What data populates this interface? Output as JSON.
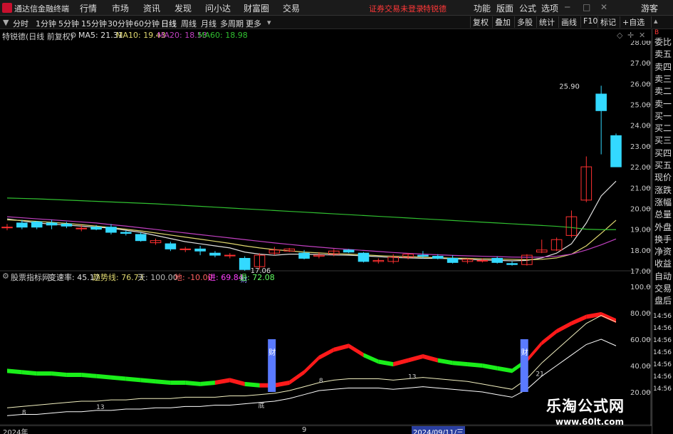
{
  "app": {
    "title": "通达信金融终端",
    "login_warning": "证券交易未登录",
    "user": "特锐德",
    "guest": "游客"
  },
  "menu": [
    "行情",
    "市场",
    "资讯",
    "发现",
    "问小达",
    "财富圈",
    "交易"
  ],
  "right_menu": [
    "功能",
    "版面",
    "公式",
    "选项"
  ],
  "periods": [
    "分时",
    "1分钟",
    "5分钟",
    "15分钟",
    "30分钟",
    "60分钟",
    "日线",
    "周线",
    "月线",
    "多周期",
    "更多"
  ],
  "active_period": "日线",
  "toolbar_right": [
    "复权",
    "叠加",
    "多股",
    "统计",
    "画线",
    "F10",
    "标记",
    "+自选"
  ],
  "main_info": {
    "name": "特锐德(日线 前复权)",
    "ma5": "MA5: 21.31",
    "ma10": "MA10: 19.43",
    "ma20": "MA20: 18.53",
    "ma60": "MA60: 18.98"
  },
  "price_axis": [
    "28.00",
    "27.00",
    "26.00",
    "25.00",
    "24.00",
    "23.00",
    "22.00",
    "21.00",
    "20.00",
    "19.00",
    "18.00",
    "17.00"
  ],
  "annotations": {
    "high": "25.90",
    "low": "17.06",
    "cai": "财",
    "di": "底"
  },
  "sub_info": {
    "name": "股票指标网",
    "rate_label": "变速率: 45.17",
    "trend": "趋势线: 76.73",
    "tian": "天: 100.00",
    "di": "地: -10.00",
    "jin": "进: 69.84",
    "tui": "退: 72.08"
  },
  "sub_axis": [
    "100.0",
    "80.00",
    "60.00",
    "40.00",
    "20.00"
  ],
  "sub_numbers": {
    "n8": "8",
    "n13": "13",
    "n13b": "13",
    "n8b": "8",
    "n21": "21"
  },
  "right_panel": [
    "委比",
    "卖五",
    "卖四",
    "卖三",
    "卖二",
    "卖一",
    "买一",
    "买二",
    "买三",
    "买四",
    "买五",
    "现价",
    "涨跌",
    "涨幅",
    "总量",
    "外盘",
    "换手",
    "净资",
    "收益",
    "自动",
    "交易",
    "盘后"
  ],
  "right_times": [
    "14:56",
    "14:56",
    "14:56",
    "14:56",
    "14:56",
    "14:56",
    "14:56"
  ],
  "bottom_axis": {
    "left": "2024年",
    "mid": "9",
    "date": "2024/09/11/三"
  },
  "watermark": {
    "title": "乐淘公式网",
    "url": "www.60lt.com"
  },
  "colors": {
    "up": "#ff3030",
    "down": "#33d9ff",
    "ma5": "#e0e0e0",
    "ma10": "#e0d870",
    "ma20": "#c040c0",
    "ma60": "#30c030",
    "red_band": "#ff1a1a",
    "green_band": "#1aee1a",
    "blue_bar": "#5a7aff"
  },
  "chart_data": {
    "type": "candlestick",
    "ylim": [
      17,
      28
    ],
    "candles": [
      {
        "o": 19.1,
        "h": 19.25,
        "l": 18.95,
        "c": 19.1
      },
      {
        "o": 19.3,
        "h": 19.45,
        "l": 19.0,
        "c": 19.1
      },
      {
        "o": 19.35,
        "h": 19.4,
        "l": 19.0,
        "c": 19.1
      },
      {
        "o": 19.3,
        "h": 19.45,
        "l": 19.0,
        "c": 19.2
      },
      {
        "o": 19.25,
        "h": 19.35,
        "l": 19.05,
        "c": 19.15
      },
      {
        "o": 19.05,
        "h": 19.2,
        "l": 18.9,
        "c": 19.05
      },
      {
        "o": 19.1,
        "h": 19.2,
        "l": 18.95,
        "c": 19.0
      },
      {
        "o": 19.1,
        "h": 19.25,
        "l": 18.75,
        "c": 18.85
      },
      {
        "o": 18.85,
        "h": 18.95,
        "l": 18.7,
        "c": 18.8
      },
      {
        "o": 18.75,
        "h": 18.85,
        "l": 18.4,
        "c": 18.45
      },
      {
        "o": 18.35,
        "h": 18.55,
        "l": 18.25,
        "c": 18.45
      },
      {
        "o": 18.3,
        "h": 18.4,
        "l": 17.95,
        "c": 18.05
      },
      {
        "o": 18.05,
        "h": 18.15,
        "l": 17.9,
        "c": 18.05
      },
      {
        "o": 18.05,
        "h": 18.2,
        "l": 17.75,
        "c": 17.95
      },
      {
        "o": 17.85,
        "h": 17.95,
        "l": 17.65,
        "c": 17.75
      },
      {
        "o": 17.75,
        "h": 17.85,
        "l": 17.6,
        "c": 17.75
      },
      {
        "o": 17.6,
        "h": 17.7,
        "l": 17.0,
        "c": 17.06
      },
      {
        "o": 17.2,
        "h": 17.85,
        "l": 17.06,
        "c": 17.75
      },
      {
        "o": 17.85,
        "h": 18.15,
        "l": 17.75,
        "c": 18.0
      },
      {
        "o": 17.95,
        "h": 18.1,
        "l": 17.9,
        "c": 18.05
      },
      {
        "o": 17.85,
        "h": 18.0,
        "l": 17.55,
        "c": 17.6
      },
      {
        "o": 17.7,
        "h": 17.9,
        "l": 17.6,
        "c": 17.75
      },
      {
        "o": 17.8,
        "h": 18.05,
        "l": 17.7,
        "c": 17.95
      },
      {
        "o": 18.0,
        "h": 18.05,
        "l": 17.85,
        "c": 17.9
      },
      {
        "o": 17.85,
        "h": 17.9,
        "l": 17.4,
        "c": 17.45
      },
      {
        "o": 17.45,
        "h": 17.6,
        "l": 17.35,
        "c": 17.5
      },
      {
        "o": 17.45,
        "h": 17.8,
        "l": 17.35,
        "c": 17.65
      },
      {
        "o": 17.65,
        "h": 17.85,
        "l": 17.55,
        "c": 17.8
      },
      {
        "o": 17.75,
        "h": 17.95,
        "l": 17.6,
        "c": 17.7
      },
      {
        "o": 17.7,
        "h": 17.8,
        "l": 17.55,
        "c": 17.6
      },
      {
        "o": 17.6,
        "h": 17.75,
        "l": 17.35,
        "c": 17.4
      },
      {
        "o": 17.45,
        "h": 17.6,
        "l": 17.35,
        "c": 17.55
      },
      {
        "o": 17.5,
        "h": 17.6,
        "l": 17.4,
        "c": 17.5
      },
      {
        "o": 17.6,
        "h": 17.7,
        "l": 17.35,
        "c": 17.4
      },
      {
        "o": 17.35,
        "h": 17.45,
        "l": 17.25,
        "c": 17.3
      },
      {
        "o": 17.3,
        "h": 17.8,
        "l": 17.25,
        "c": 17.75
      },
      {
        "o": 17.9,
        "h": 18.5,
        "l": 17.85,
        "c": 18.0
      },
      {
        "o": 18.0,
        "h": 18.6,
        "l": 17.95,
        "c": 18.5
      },
      {
        "o": 18.7,
        "h": 19.9,
        "l": 18.6,
        "c": 19.6
      },
      {
        "o": 20.4,
        "h": 22.5,
        "l": 20.3,
        "c": 22.0
      },
      {
        "o": 25.5,
        "h": 25.9,
        "l": 22.6,
        "c": 24.7
      },
      {
        "o": 23.5,
        "h": 23.6,
        "l": 22.0,
        "c": 22.0
      }
    ],
    "series": [
      {
        "name": "MA5",
        "values": [
          19.5,
          19.4,
          19.3,
          19.25,
          19.2,
          19.15,
          19.1,
          19.05,
          18.95,
          18.85,
          18.7,
          18.55,
          18.4,
          18.3,
          18.2,
          18.1,
          17.9,
          17.8,
          17.75,
          17.8,
          17.8,
          17.78,
          17.76,
          17.75,
          17.72,
          17.68,
          17.64,
          17.62,
          17.6,
          17.6,
          17.58,
          17.55,
          17.52,
          17.5,
          17.48,
          17.5,
          17.62,
          17.85,
          18.3,
          19.3,
          20.6,
          21.31
        ]
      },
      {
        "name": "MA10",
        "values": [
          19.45,
          19.42,
          19.38,
          19.33,
          19.28,
          19.22,
          19.15,
          19.08,
          19.0,
          18.92,
          18.82,
          18.72,
          18.62,
          18.52,
          18.42,
          18.32,
          18.2,
          18.1,
          18.02,
          17.96,
          17.9,
          17.86,
          17.82,
          17.8,
          17.77,
          17.73,
          17.7,
          17.68,
          17.65,
          17.63,
          17.61,
          17.6,
          17.58,
          17.56,
          17.55,
          17.53,
          17.55,
          17.62,
          17.8,
          18.2,
          18.8,
          19.43
        ]
      },
      {
        "name": "MA20",
        "values": [
          19.6,
          19.55,
          19.5,
          19.45,
          19.4,
          19.35,
          19.3,
          19.22,
          19.15,
          19.07,
          18.99,
          18.9,
          18.82,
          18.74,
          18.66,
          18.58,
          18.5,
          18.42,
          18.34,
          18.27,
          18.2,
          18.14,
          18.08,
          18.03,
          17.98,
          17.93,
          17.88,
          17.84,
          17.8,
          17.77,
          17.74,
          17.72,
          17.7,
          17.68,
          17.66,
          17.65,
          17.66,
          17.7,
          17.8,
          18.0,
          18.25,
          18.53
        ]
      },
      {
        "name": "MA60",
        "values": [
          20.5,
          20.48,
          20.46,
          20.43,
          20.4,
          20.37,
          20.34,
          20.31,
          20.28,
          20.25,
          20.22,
          20.18,
          20.14,
          20.1,
          20.06,
          20.02,
          19.98,
          19.94,
          19.9,
          19.86,
          19.82,
          19.78,
          19.74,
          19.7,
          19.66,
          19.62,
          19.58,
          19.54,
          19.5,
          19.46,
          19.42,
          19.38,
          19.34,
          19.3,
          19.26,
          19.22,
          19.18,
          19.14,
          19.08,
          19.0,
          18.98,
          18.98
        ]
      }
    ],
    "indicator": {
      "ylim": [
        0,
        100
      ],
      "band": [
        36,
        35,
        34,
        34,
        33,
        33,
        32,
        31,
        30,
        29,
        28,
        27,
        27,
        26,
        27,
        29,
        26,
        25,
        25,
        27,
        35,
        46,
        52,
        55,
        48,
        43,
        41,
        44,
        47,
        44,
        42,
        41,
        40,
        38,
        36,
        44,
        57,
        66,
        72,
        77,
        79,
        74
      ],
      "band_color": [
        "g",
        "g",
        "g",
        "g",
        "g",
        "g",
        "g",
        "g",
        "g",
        "g",
        "g",
        "g",
        "g",
        "g",
        "r",
        "r",
        "g",
        "r",
        "r",
        "r",
        "r",
        "r",
        "r",
        "r",
        "g",
        "g",
        "r",
        "r",
        "r",
        "g",
        "g",
        "g",
        "g",
        "g",
        "g",
        "r",
        "r",
        "r",
        "r",
        "r",
        "r",
        "r"
      ],
      "line1": [
        8,
        9,
        10,
        11,
        12,
        13,
        13,
        14,
        14,
        15,
        15,
        15,
        16,
        16,
        16,
        17,
        17,
        18,
        19,
        21,
        24,
        27,
        29,
        30,
        30,
        30,
        29,
        30,
        31,
        30,
        29,
        28,
        26,
        24,
        22,
        30,
        42,
        52,
        62,
        72,
        78,
        73
      ],
      "line2": [
        2,
        3,
        3,
        4,
        5,
        5,
        6,
        6,
        7,
        7,
        8,
        8,
        9,
        9,
        10,
        10,
        11,
        12,
        13,
        15,
        18,
        21,
        22,
        23,
        23,
        23,
        22,
        23,
        24,
        23,
        22,
        21,
        20,
        18,
        16,
        22,
        32,
        40,
        48,
        56,
        60,
        55
      ]
    }
  }
}
